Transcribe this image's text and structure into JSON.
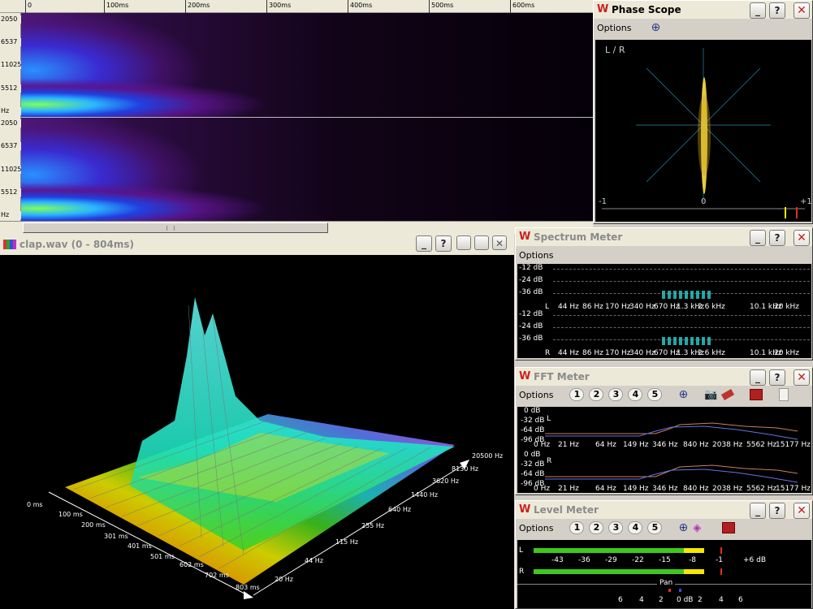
{
  "ruler": {
    "ticks": [
      "0",
      "100ms",
      "200ms",
      "300ms",
      "400ms",
      "500ms",
      "600ms"
    ]
  },
  "spectrogram": {
    "hz_labels": [
      "2050",
      "6537",
      "11025",
      "5512",
      "Hz"
    ]
  },
  "clip_window": {
    "title": "clap.wav (0 - 804ms)",
    "buttons": [
      "_",
      "?"
    ]
  },
  "surface3d": {
    "time_labels": [
      "0 ms",
      "100 ms",
      "200 ms",
      "301 ms",
      "401 ms",
      "501 ms",
      "602 ms",
      "702 ms",
      "803 ms"
    ],
    "freq_labels": [
      "20500 Hz",
      "8130 Hz",
      "3620 Hz",
      "1440 Hz",
      "640 Hz",
      "255 Hz",
      "115 Hz",
      "44 Hz",
      "20 Hz"
    ]
  },
  "phase_scope": {
    "title": "Phase Scope",
    "menu": "Options",
    "channel": "L / R",
    "axis": [
      "-1",
      "0",
      "+1"
    ]
  },
  "spectrum_meter": {
    "title": "Spectrum Meter",
    "menu": "Options",
    "db": [
      "-12 dB",
      "-24 dB",
      "-36 dB"
    ],
    "freqs": [
      "44 Hz",
      "86 Hz",
      "170 Hz",
      "340 Hz",
      "670 Hz",
      "1.3 kHz",
      "2.6 kHz",
      "10.1 kHz",
      "20 kHz"
    ],
    "ch": [
      "L",
      "R"
    ]
  },
  "fft_meter": {
    "title": "FFT Meter",
    "menu": "Options",
    "presets": [
      "1",
      "2",
      "3",
      "4",
      "5"
    ],
    "db": [
      "0 dB",
      "-32 dB",
      "-64 dB",
      "-96 dB"
    ],
    "freqs": [
      "0 Hz",
      "21 Hz",
      "64 Hz",
      "149 Hz",
      "346 Hz",
      "840 Hz",
      "2038 Hz",
      "5562 Hz",
      "15177 Hz"
    ],
    "ch": [
      "L",
      "R"
    ]
  },
  "level_meter": {
    "title": "Level Meter",
    "menu": "Options",
    "presets": [
      "1",
      "2",
      "3",
      "4",
      "5"
    ],
    "scale": [
      "-43",
      "-36",
      "-29",
      "-22",
      "-15",
      "-8",
      "-1",
      "+6 dB"
    ],
    "ch": [
      "L",
      "R"
    ],
    "pan_label": "Pan",
    "pan_scale": [
      "6",
      "4",
      "2",
      "0 dB",
      "2",
      "4",
      "6"
    ]
  },
  "colors": {
    "accent": "#cc2020",
    "background": "#000000",
    "meter_green": "#3ec81e",
    "meter_yellow": "#f4e800"
  }
}
